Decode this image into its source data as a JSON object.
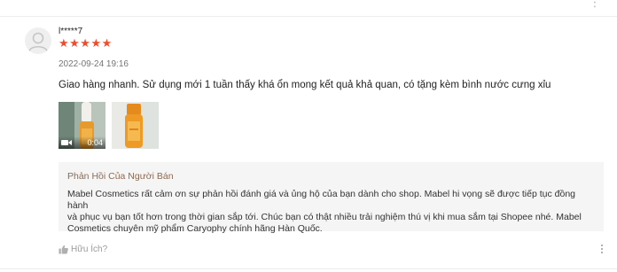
{
  "review": {
    "username": "l*****7",
    "rating": "★★★★★",
    "timestamp": "2022-09-24 19:16",
    "text": "Giao hàng nhanh. Sử dụng mới 1 tuần thấy khá ổn mong kết quả khả quan, có tặng kèm bình nước cưng xỉu",
    "media": {
      "video_duration": "0:04"
    }
  },
  "seller_reply": {
    "title": "Phản Hồi Của Người Bán",
    "line1": "Mabel Cosmetics rất cảm ơn sự phản hồi đánh giá và ủng hộ của bạn dành cho shop. Mabel hi vọng sẽ được tiếp tục đồng hành",
    "line2": "và phục vụ bạn tốt hơn trong thời gian sắp tới. Chúc bạn có thật nhiều trải nghiệm thú vị khi mua sắm tại Shopee nhé. Mabel",
    "line3": "Cosmetics chuyên mỹ phẩm Caryophy chính hãng Hàn Quốc."
  },
  "footer": {
    "helpful_label": "Hữu Ích?"
  },
  "colors": {
    "star": "#ee4d2d",
    "reply_title": "#8c6a55",
    "reply_bg": "#f5f5f5"
  },
  "icons": {
    "avatar": "user-silhouette-icon",
    "video": "video-camera-icon",
    "helpful": "thumbs-up-icon",
    "more": "more-vertical-icon"
  }
}
